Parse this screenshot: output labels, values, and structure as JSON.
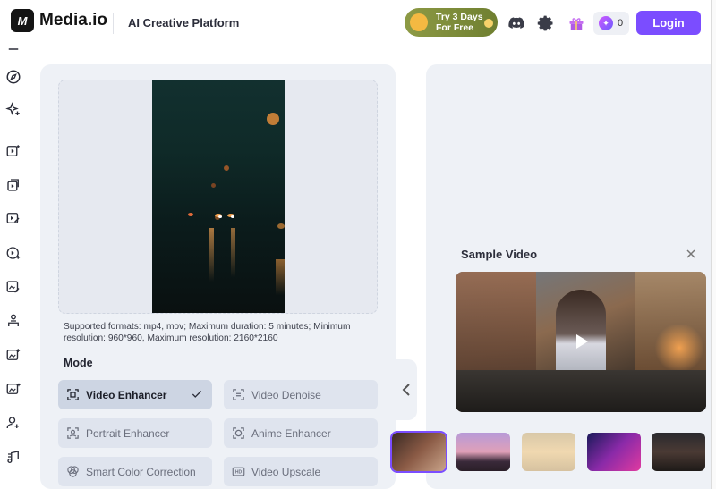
{
  "header": {
    "logo_mark": "M",
    "logo_text": "Media.io",
    "platform": "AI Creative Platform",
    "promo_line1": "Try 3 Days",
    "promo_line2": "For Free",
    "credits": "0",
    "login_label": "Login",
    "icons": [
      "discord-icon",
      "gear-icon",
      "gift-icon",
      "credits-star-icon"
    ]
  },
  "sidebar": {
    "icons": [
      "explore-icon",
      "sparkle-icon",
      "video-ai-icon",
      "video-edit-icon",
      "video-sketch-icon",
      "video-enhance-icon",
      "image-edit-icon",
      "avatar-icon",
      "image-enhance-icon",
      "image-generate-icon",
      "person-add-icon",
      "music-icon"
    ]
  },
  "upload": {
    "formats_text": "Supported formats: mp4, mov; Maximum duration: 5 minutes; Minimum resolution: 960*960, Maximum resolution: 2160*2160"
  },
  "mode": {
    "title": "Mode",
    "options": [
      {
        "label": "Video Enhancer",
        "icon": "scan-frame-icon",
        "selected": true
      },
      {
        "label": "Video Denoise",
        "icon": "denoise-icon",
        "selected": false
      },
      {
        "label": "Portrait Enhancer",
        "icon": "portrait-icon",
        "selected": false
      },
      {
        "label": "Anime Enhancer",
        "icon": "anime-face-icon",
        "selected": false
      },
      {
        "label": "Smart Color Correction",
        "icon": "color-circles-icon",
        "selected": false
      },
      {
        "label": "Video Upscale",
        "icon": "hd-icon",
        "selected": false
      }
    ]
  },
  "sample": {
    "title": "Sample Video",
    "thumbnails": [
      "sample-thumb-1",
      "sample-thumb-2",
      "sample-thumb-3",
      "sample-thumb-4",
      "sample-thumb-5"
    ]
  },
  "colors": {
    "accent": "#7b4dff",
    "panel_bg": "#eef1f6",
    "mode_active_bg": "#cdd5e3"
  }
}
